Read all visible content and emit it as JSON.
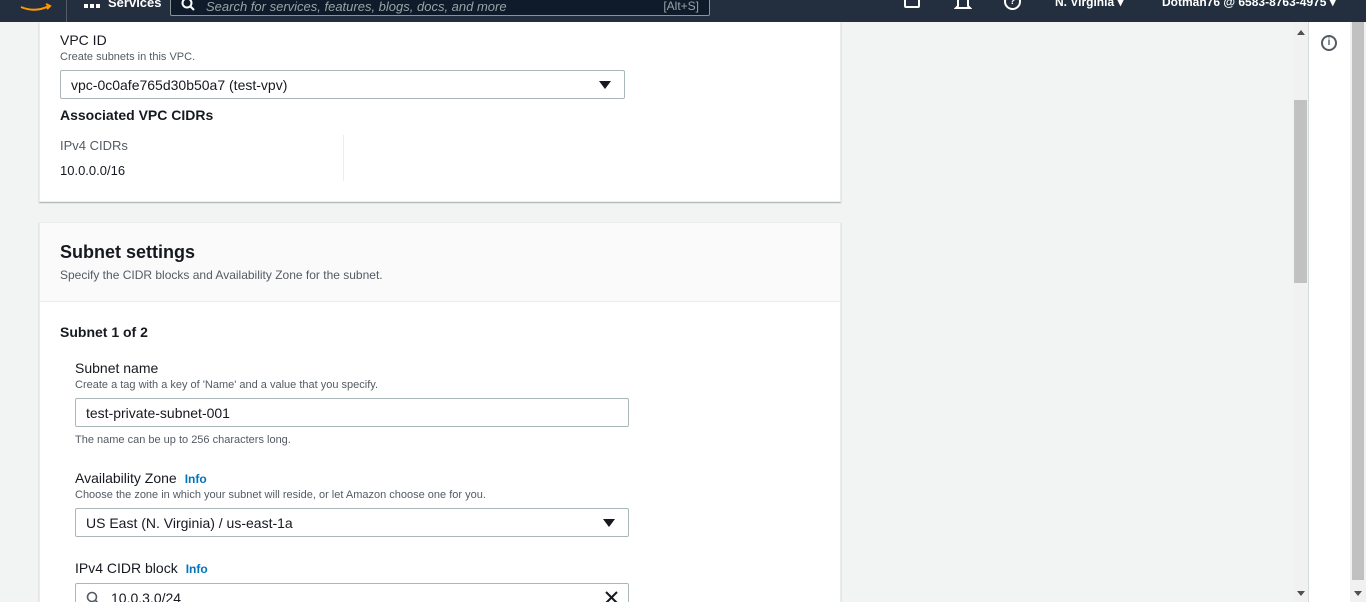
{
  "topnav": {
    "services_label": "Services",
    "search_placeholder": "Search for services, features, blogs, docs, and more",
    "search_shortcut": "[Alt+S]",
    "region": "N. Virginia ▾",
    "account": "Dotman76 @ 6583-8763-4975 ▾"
  },
  "vpc": {
    "label": "VPC ID",
    "description": "Create subnets in this VPC.",
    "selected": "vpc-0c0afe765d30b50a7 (test-vpv)",
    "associated_heading": "Associated VPC CIDRs",
    "ipv4_label": "IPv4 CIDRs",
    "ipv4_value": "10.0.0.0/16"
  },
  "subnet_settings": {
    "title": "Subnet settings",
    "description": "Specify the CIDR blocks and Availability Zone for the subnet.",
    "subnet_heading": "Subnet 1 of 2",
    "name_label": "Subnet name",
    "name_description": "Create a tag with a key of 'Name' and a value that you specify.",
    "name_value": "test-private-subnet-001",
    "name_hint": "The name can be up to 256 characters long.",
    "az_label": "Availability Zone",
    "az_info": "Info",
    "az_description": "Choose the zone in which your subnet will reside, or let Amazon choose one for you.",
    "az_selected": "US East (N. Virginia) / us-east-1a",
    "cidr_label": "IPv4 CIDR block",
    "cidr_info": "Info",
    "cidr_value": "10.0.3.0/24"
  },
  "colors": {
    "nav_bg": "#232f3e",
    "link": "#0073bb"
  }
}
